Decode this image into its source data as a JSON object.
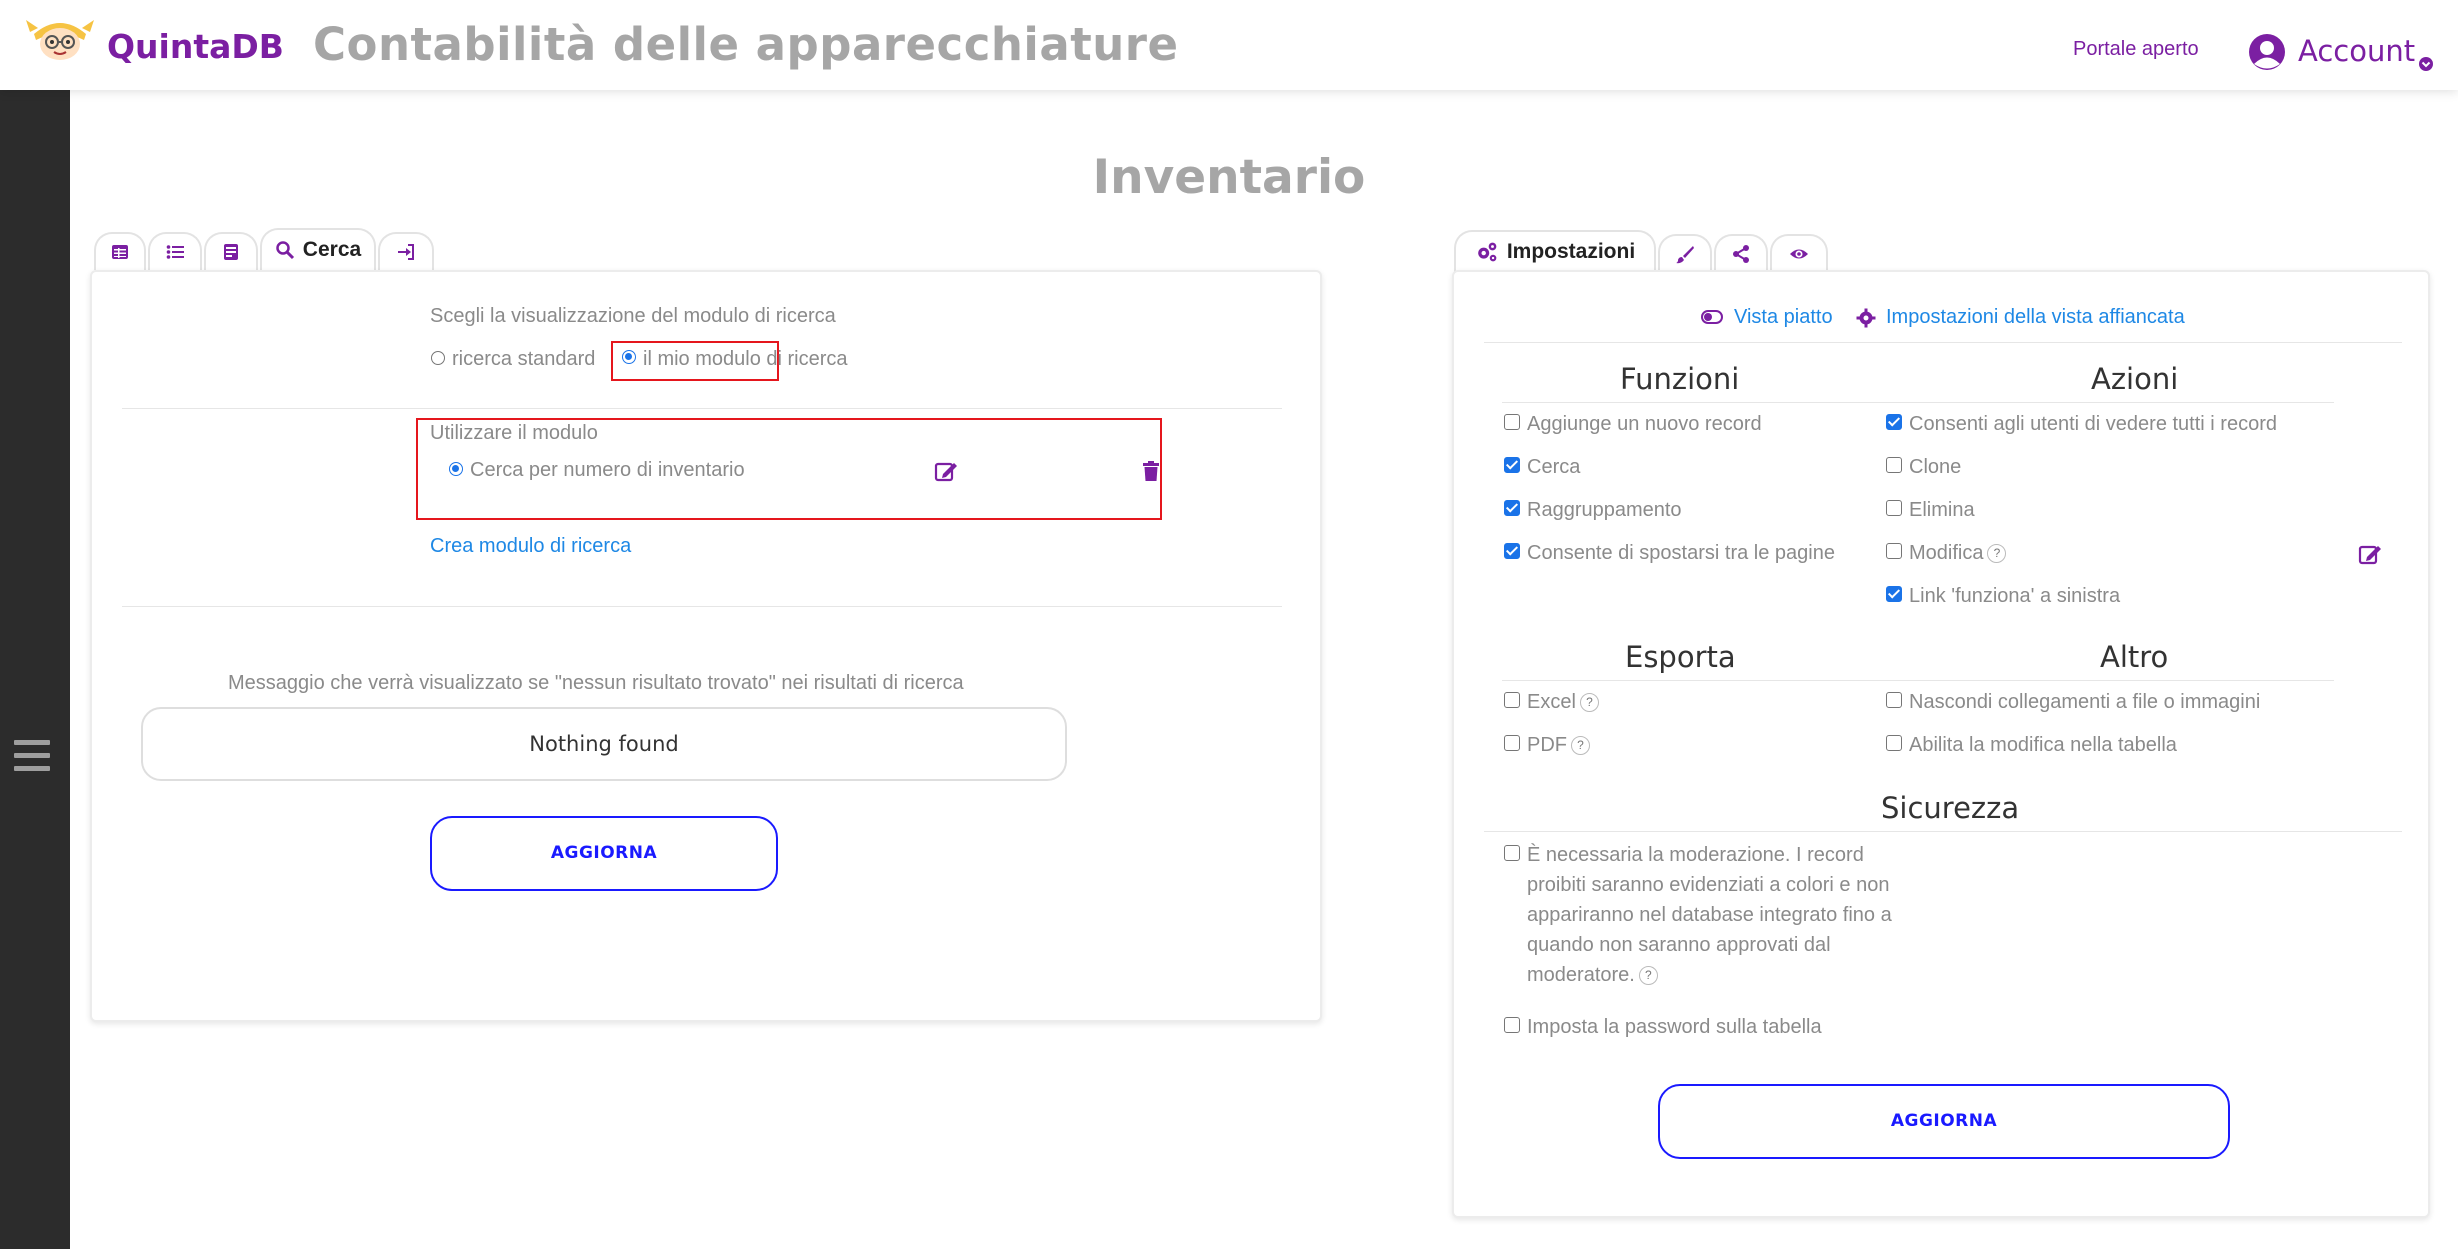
{
  "header": {
    "brand": "QuintaDB",
    "app_title": "Contabilità delle apparecchiature",
    "portal_link": "Portale aperto",
    "account_label": "Account"
  },
  "page": {
    "title": "Inventario"
  },
  "left_tabs": [
    {
      "icon": "table-icon",
      "label": ""
    },
    {
      "icon": "list-icon",
      "label": ""
    },
    {
      "icon": "form-icon",
      "label": ""
    },
    {
      "icon": "search-icon",
      "label": "Cerca"
    },
    {
      "icon": "sign-in-icon",
      "label": ""
    }
  ],
  "search_panel": {
    "view_label": "Scegli la visualizzazione del modulo di ricerca",
    "radio_standard": "ricerca standard",
    "radio_custom": "il mio modulo di ricerca",
    "use_form_label": "Utilizzare il modulo",
    "form_option": "Cerca per numero di inventario",
    "create_link": "Crea modulo di ricerca",
    "no_results_label": "Messaggio che verrà visualizzato se \"nessun risultato trovato\" nei risultati di ricerca",
    "no_results_value": "Nothing found",
    "update_button": "AGGIORNA"
  },
  "right_tabs": [
    {
      "icon": "gears-icon",
      "label": "Impostazioni"
    },
    {
      "icon": "brush-icon",
      "label": ""
    },
    {
      "icon": "share-icon",
      "label": ""
    },
    {
      "icon": "eye-icon",
      "label": ""
    }
  ],
  "settings_panel": {
    "flat_view_link": "Vista piatto",
    "tile_view_link": "Impostazioni della vista affiancata",
    "funzioni": {
      "title": "Funzioni",
      "items": [
        {
          "label": "Aggiunge un nuovo record",
          "checked": false
        },
        {
          "label": "Cerca",
          "checked": true
        },
        {
          "label": "Raggruppamento",
          "checked": true
        },
        {
          "label": "Consente di spostarsi tra le pagine",
          "checked": true
        }
      ]
    },
    "azioni": {
      "title": "Azioni",
      "items": [
        {
          "label": "Consenti agli utenti di vedere tutti i record",
          "checked": true
        },
        {
          "label": "Clone",
          "checked": false
        },
        {
          "label": "Elimina",
          "checked": false
        },
        {
          "label": "Modifica",
          "checked": false
        },
        {
          "label": "Link 'funziona' a sinistra",
          "checked": true
        }
      ]
    },
    "esporta": {
      "title": "Esporta",
      "items": [
        {
          "label": "Excel",
          "checked": false
        },
        {
          "label": "PDF",
          "checked": false
        }
      ]
    },
    "altro": {
      "title": "Altro",
      "items": [
        {
          "label": "Nascondi collegamenti a file o immagini",
          "checked": false
        },
        {
          "label": "Abilita la modifica nella tabella",
          "checked": false
        }
      ]
    },
    "sicurezza": {
      "title": "Sicurezza",
      "moderation_lines": [
        "È necessaria la moderazione. I record",
        "proibiti saranno evidenziati a colori e non",
        "appariranno nel database integrato fino a",
        "quando non saranno approvati dal",
        "moderatore."
      ],
      "password_label": "Imposta la password sulla tabella"
    },
    "help_mark": "?",
    "update_button": "AGGIORNA"
  },
  "colors": {
    "brand": "#7b1fa2",
    "link": "#1e88e5",
    "button": "#1a1aff",
    "highlight": "#e5161d",
    "sidebar": "#2c2c2c"
  }
}
